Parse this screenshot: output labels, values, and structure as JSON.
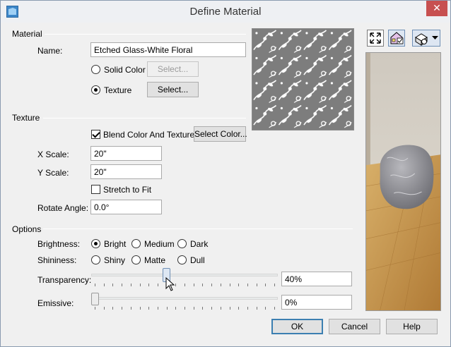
{
  "window": {
    "title": "Define Material",
    "close_glyph": "✕"
  },
  "material": {
    "group_label": "Material",
    "name_label": "Name:",
    "name_value": "Etched Glass-White Floral",
    "solid_color_label": "Solid Color",
    "solid_color_select": "Select...",
    "texture_label": "Texture",
    "texture_select": "Select...",
    "selected_source": "Texture"
  },
  "texture": {
    "group_label": "Texture",
    "blend_label": "Blend Color And Texture",
    "blend_checked": true,
    "select_color": "Select Color...",
    "x_scale_label": "X Scale:",
    "x_scale_value": "20\"",
    "y_scale_label": "Y Scale:",
    "y_scale_value": "20\"",
    "stretch_label": "Stretch to Fit",
    "stretch_checked": false,
    "rotate_label": "Rotate Angle:",
    "rotate_value": "0.0°"
  },
  "options": {
    "group_label": "Options",
    "brightness_label": "Brightness:",
    "brightness_options": [
      "Bright",
      "Medium",
      "Dark"
    ],
    "brightness_selected": "Bright",
    "shininess_label": "Shininess:",
    "shininess_options": [
      "Shiny",
      "Matte",
      "Dull"
    ],
    "shininess_selected": null,
    "transparency_label": "Transparency:",
    "transparency_value": "40%",
    "transparency_level": 0.4,
    "emissive_label": "Emissive:",
    "emissive_value": "0%",
    "emissive_level": 0
  },
  "preview_tools": {
    "icons": [
      "fullscreen-icon",
      "house-preview-icon",
      "render-options-icon",
      "dropdown-arrow-icon"
    ]
  },
  "buttons": {
    "ok": "OK",
    "cancel": "Cancel",
    "help": "Help"
  },
  "colors": {
    "texture_bg": "#7d7d7d",
    "floor_wood": "#c59a4e",
    "wall": "#dcd6cc",
    "default_button_border": "#3c7fb1"
  }
}
